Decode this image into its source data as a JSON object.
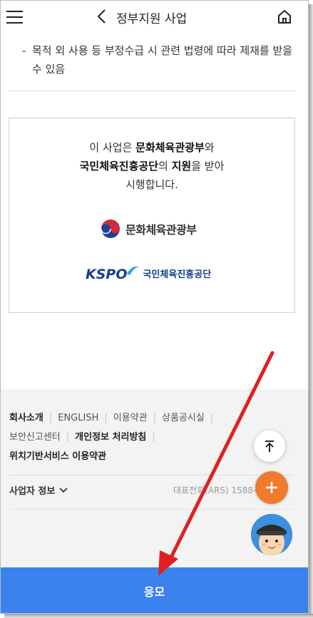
{
  "header": {
    "title": "정부지원 사업",
    "menu_icon": "hamburger-menu-icon",
    "back_icon": "chevron-left-icon",
    "home_icon": "home-icon"
  },
  "notice": {
    "bullet": "-",
    "text": "목적 외 사용 등 부정수급 시 관련 법령에 따라 제재를 받을 수 있음"
  },
  "support": {
    "line1_pre": "이 사업은 ",
    "line1_org": "문화체육관광부",
    "line1_post": "와",
    "line2_org": "국민체육진흥공단",
    "line2_mid": "의 ",
    "line2_support": "지원",
    "line2_post": "을 받아",
    "line3": "시행합니다.",
    "logo1_name": "문화체육관광부",
    "logo2_mark": "KSPO",
    "logo2_name": "국민체육진흥공단"
  },
  "footer": {
    "links_row1": [
      "회사소개",
      "ENGLISH",
      "이용약관",
      "상품공시실"
    ],
    "links_row2": [
      "보안신고센터",
      "개인정보 처리방침"
    ],
    "links_row3": [
      "위치기반서비스 이용약관"
    ],
    "biz_info_label": "사업자 정보",
    "phone": "대표전화(ARS) 1588-0100"
  },
  "fabs": {
    "top_icon": "arrow-up-to-top-icon",
    "plus_icon": "plus-icon",
    "bot_icon": "chatbot-avatar-icon"
  },
  "apply": {
    "label": "응모"
  },
  "colors": {
    "accent": "#3b82ee",
    "fab_orange": "#f07a2e",
    "annotation_red": "#e02020",
    "kspo_blue": "#1a3d8f"
  }
}
